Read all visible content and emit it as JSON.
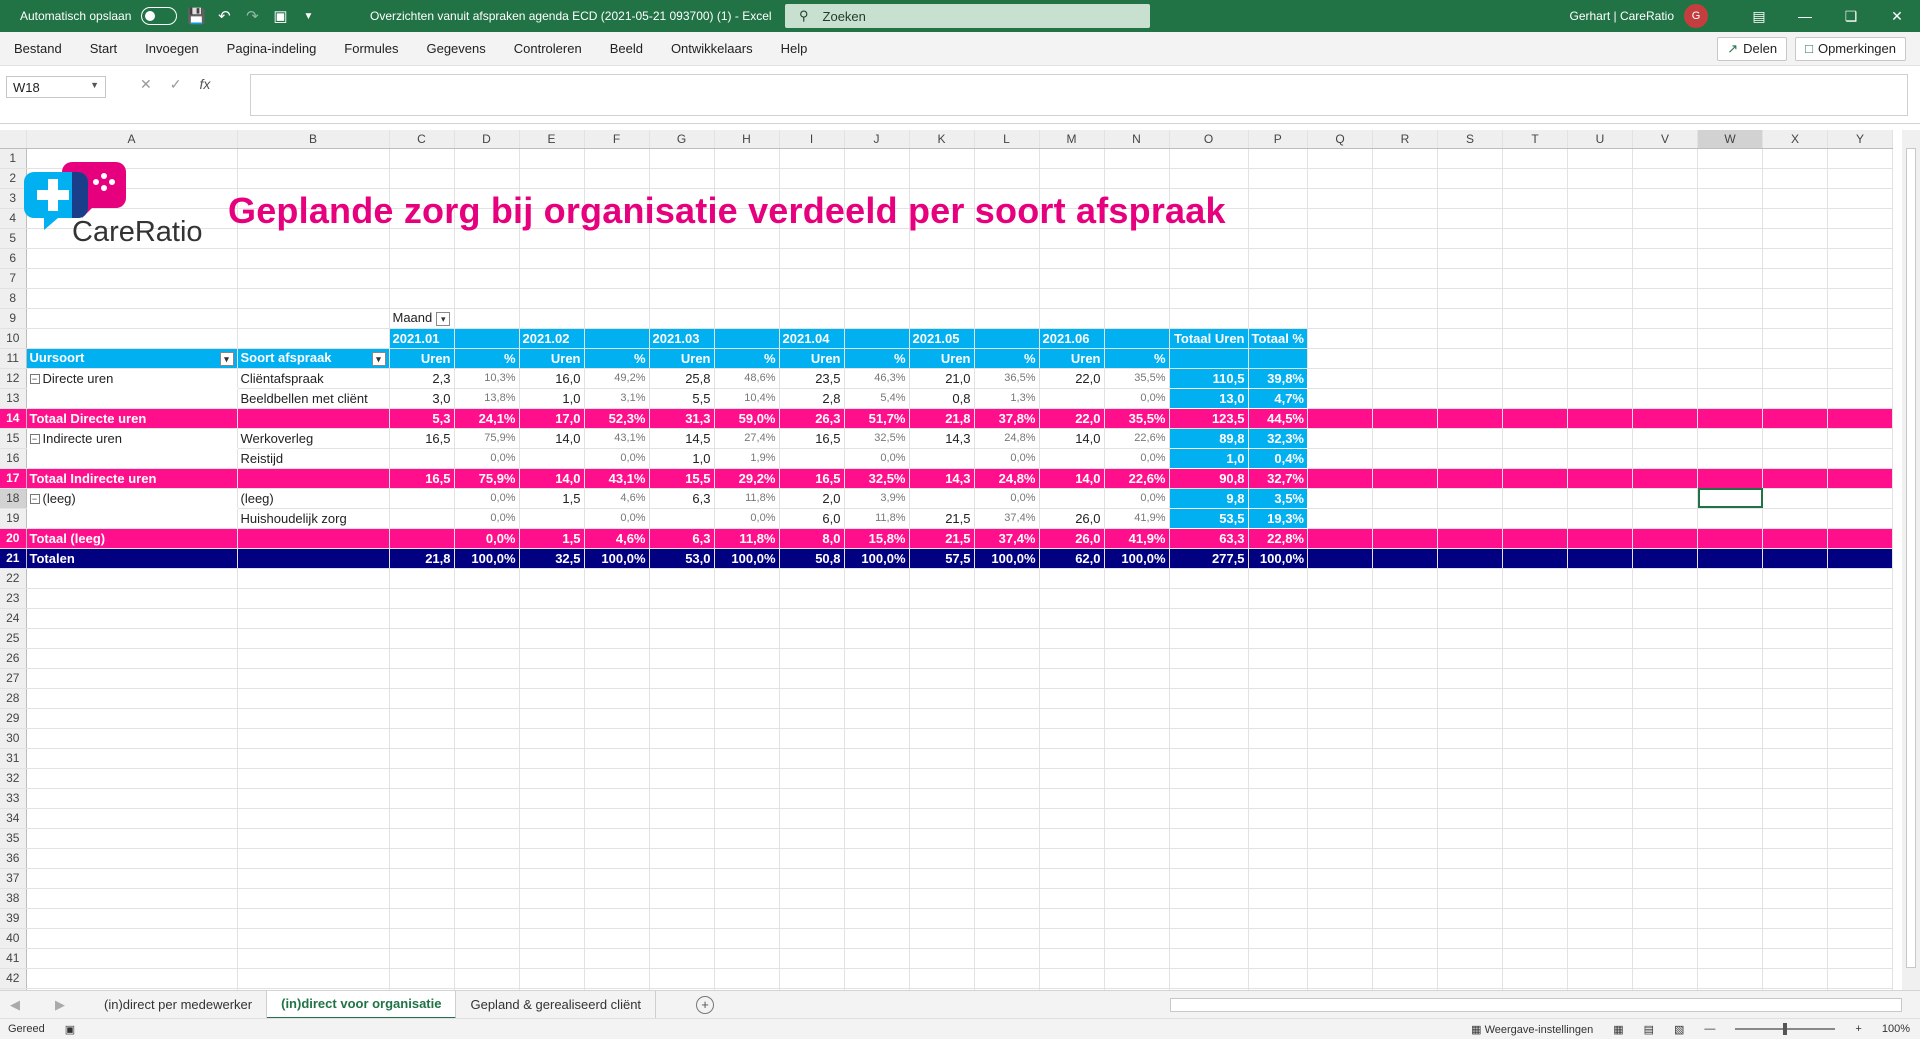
{
  "titlebar": {
    "autosave_label": "Automatisch opslaan",
    "doc_title": "Overzichten vanuit afspraken agenda ECD (2021-05-21 093700) (1)  -  Excel",
    "search_placeholder": "Zoeken",
    "user_name": "Gerhart | CareRatio",
    "avatar_initial": "G"
  },
  "menu": [
    "Bestand",
    "Start",
    "Invoegen",
    "Pagina-indeling",
    "Formules",
    "Gegevens",
    "Controleren",
    "Beeld",
    "Ontwikkelaars",
    "Help"
  ],
  "menu_right": {
    "share": "Delen",
    "comments": "Opmerkingen"
  },
  "namebox": "W18",
  "columns": [
    "A",
    "B",
    "C",
    "D",
    "E",
    "F",
    "G",
    "H",
    "I",
    "J",
    "K",
    "L",
    "M",
    "N",
    "O",
    "P",
    "Q",
    "R",
    "S",
    "T",
    "U",
    "V",
    "W",
    "X",
    "Y"
  ],
  "logo_text": "CareRatio",
  "sheet_title": "Geplande zorg bij organisatie verdeeld per soort afspraak",
  "pivot": {
    "filter_label": "Maand",
    "months": [
      "2021.01",
      "2021.02",
      "2021.03",
      "2021.04",
      "2021.05",
      "2021.06"
    ],
    "total_hours_label": "Totaal Uren",
    "total_pct_label": "Totaal %",
    "row_header_1": "Uursoort",
    "row_header_2": "Soort afspraak",
    "sub_uren": "Uren",
    "sub_pct": "%",
    "rows": [
      {
        "r": 12,
        "type": "data",
        "a": "Directe uren",
        "exp": true,
        "b": "Cliëntafspraak",
        "vals": [
          "2,3",
          "10,3%",
          "16,0",
          "49,2%",
          "25,8",
          "48,6%",
          "23,5",
          "46,3%",
          "21,0",
          "36,5%",
          "22,0",
          "35,5%"
        ],
        "tot": "110,5",
        "totp": "39,8%"
      },
      {
        "r": 13,
        "type": "data",
        "a": "",
        "exp": false,
        "b": "Beeldbellen met cliënt",
        "vals": [
          "3,0",
          "13,8%",
          "1,0",
          "3,1%",
          "5,5",
          "10,4%",
          "2,8",
          "5,4%",
          "0,8",
          "1,3%",
          "",
          "0,0%"
        ],
        "tot": "13,0",
        "totp": "4,7%"
      },
      {
        "r": 14,
        "type": "total",
        "a": "Totaal Directe uren",
        "vals": [
          "5,3",
          "24,1%",
          "17,0",
          "52,3%",
          "31,3",
          "59,0%",
          "26,3",
          "51,7%",
          "21,8",
          "37,8%",
          "22,0",
          "35,5%"
        ],
        "tot": "123,5",
        "totp": "44,5%"
      },
      {
        "r": 15,
        "type": "data",
        "a": "Indirecte uren",
        "exp": true,
        "b": "Werkoverleg",
        "vals": [
          "16,5",
          "75,9%",
          "14,0",
          "43,1%",
          "14,5",
          "27,4%",
          "16,5",
          "32,5%",
          "14,3",
          "24,8%",
          "14,0",
          "22,6%"
        ],
        "tot": "89,8",
        "totp": "32,3%"
      },
      {
        "r": 16,
        "type": "data",
        "a": "",
        "exp": false,
        "b": "Reistijd",
        "vals": [
          "",
          "0,0%",
          "",
          "0,0%",
          "1,0",
          "1,9%",
          "",
          "0,0%",
          "",
          "0,0%",
          "",
          "0,0%"
        ],
        "tot": "1,0",
        "totp": "0,4%"
      },
      {
        "r": 17,
        "type": "total",
        "a": "Totaal Indirecte uren",
        "vals": [
          "16,5",
          "75,9%",
          "14,0",
          "43,1%",
          "15,5",
          "29,2%",
          "16,5",
          "32,5%",
          "14,3",
          "24,8%",
          "14,0",
          "22,6%"
        ],
        "tot": "90,8",
        "totp": "32,7%"
      },
      {
        "r": 18,
        "type": "data",
        "a": "(leeg)",
        "exp": true,
        "b": "(leeg)",
        "vals": [
          "",
          "0,0%",
          "1,5",
          "4,6%",
          "6,3",
          "11,8%",
          "2,0",
          "3,9%",
          "",
          "0,0%",
          "",
          "0,0%"
        ],
        "tot": "9,8",
        "totp": "3,5%"
      },
      {
        "r": 19,
        "type": "data",
        "a": "",
        "exp": false,
        "b": "Huishoudelijk zorg",
        "vals": [
          "",
          "0,0%",
          "",
          "0,0%",
          "",
          "0,0%",
          "6,0",
          "11,8%",
          "21,5",
          "37,4%",
          "26,0",
          "41,9%"
        ],
        "tot": "53,5",
        "totp": "19,3%"
      },
      {
        "r": 20,
        "type": "total",
        "a": "Totaal (leeg)",
        "vals": [
          "",
          "0,0%",
          "1,5",
          "4,6%",
          "6,3",
          "11,8%",
          "8,0",
          "15,8%",
          "21,5",
          "37,4%",
          "26,0",
          "41,9%"
        ],
        "tot": "63,3",
        "totp": "22,8%"
      },
      {
        "r": 21,
        "type": "grand",
        "a": "Totalen",
        "vals": [
          "21,8",
          "100,0%",
          "32,5",
          "100,0%",
          "53,0",
          "100,0%",
          "50,8",
          "100,0%",
          "57,5",
          "100,0%",
          "62,0",
          "100,0%"
        ],
        "tot": "277,5",
        "totp": "100,0%"
      }
    ]
  },
  "sheet_tabs": [
    "(in)direct per medewerker",
    "(in)direct voor organisatie",
    "Gepland & gerealiseerd cliënt"
  ],
  "active_tab": 1,
  "status": {
    "ready": "Gereed",
    "display_settings": "Weergave-instellingen",
    "zoom": "100%"
  },
  "colors": {
    "excel_green": "#217346",
    "pink": "#ff0f8b",
    "blue": "#00b0f0",
    "navy": "#000080",
    "title_pink": "#e6007e"
  }
}
